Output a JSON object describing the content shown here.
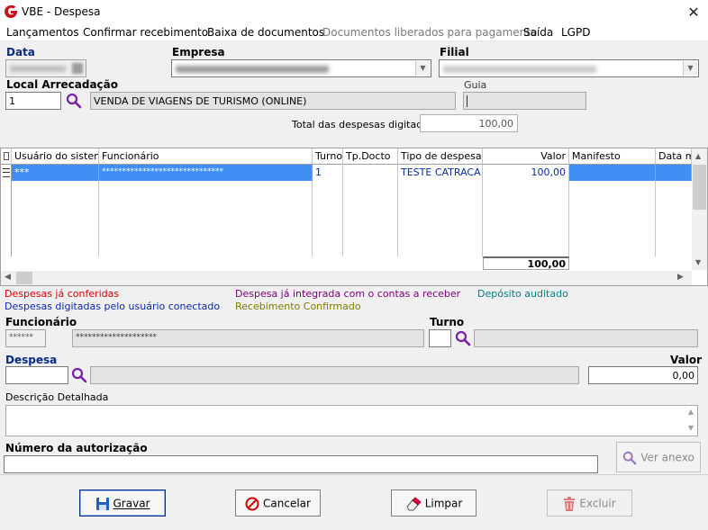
{
  "window": {
    "title": "VBE - Despesa"
  },
  "menu": [
    "Lançamentos",
    "Confirmar recebimento",
    "Baixa de documentos",
    "Documentos liberados para pagamento",
    "Saída",
    "LGPD"
  ],
  "header": {
    "data_label": "Data",
    "empresa_label": "Empresa",
    "filial_label": "Filial",
    "local_label": "Local Arrecadação",
    "local_code": "1",
    "local_name": "VENDA DE VIAGENS DE TURISMO (ONLINE)",
    "guia_label": "Guia",
    "guia_value": "",
    "total_label": "Total das despesas digitadas",
    "total_value": "100,00",
    "data_value": "",
    "empresa_value": "",
    "filial_value": ""
  },
  "grid": {
    "columns": [
      "Usuário do sistema",
      "Funcionário",
      "Turno",
      "Tp.Docto",
      "Tipo de despesa",
      "Valor",
      "Manifesto",
      "Data m"
    ],
    "rows": [
      {
        "usuario": "***",
        "funcionario": "******************************",
        "turno": "1",
        "tpdocto": "",
        "tipo": "TESTE CATRACA",
        "valor": "100,00",
        "manifesto": "",
        "data": ""
      }
    ],
    "footer_total": "100,00"
  },
  "legend": {
    "conferidas": "Despesas já conferidas",
    "digitadas": "Despesas digitadas pelo usuário conectado",
    "integrada": "Despesa já integrada com o contas a receber",
    "recebimento": "Recebimento Confirmado",
    "deposito": "Depósito auditado"
  },
  "colors": {
    "conferidas": "#e00000",
    "digitadas": "#0b2aa8",
    "integrada": "#800080",
    "recebimento": "#7d7d00",
    "deposito": "#008080",
    "selection": "#3f8ef3",
    "accent": "#0b2a84"
  },
  "form": {
    "funcionario_label": "Funcionário",
    "funcionario_code": "******",
    "funcionario_name": "********************",
    "turno_label": "Turno",
    "turno_value": "",
    "despesa_label": "Despesa",
    "despesa_code": "",
    "despesa_desc": "",
    "valor_label": "Valor",
    "valor_value": "0,00",
    "descricao_label": "Descrição Detalhada",
    "descricao_value": "",
    "autorizacao_label": "Número da autorização",
    "autorizacao_value": "",
    "ver_anexo": "Ver anexo"
  },
  "buttons": {
    "gravar": "Gravar",
    "cancelar": "Cancelar",
    "limpar": "Limpar",
    "excluir": "Excluir"
  },
  "icons": {
    "app": "vbe-logo-icon",
    "search": "magnifier-icon",
    "save": "floppy-icon",
    "cancel": "no-entry-icon",
    "clear": "eraser-icon",
    "delete": "trash-icon"
  }
}
